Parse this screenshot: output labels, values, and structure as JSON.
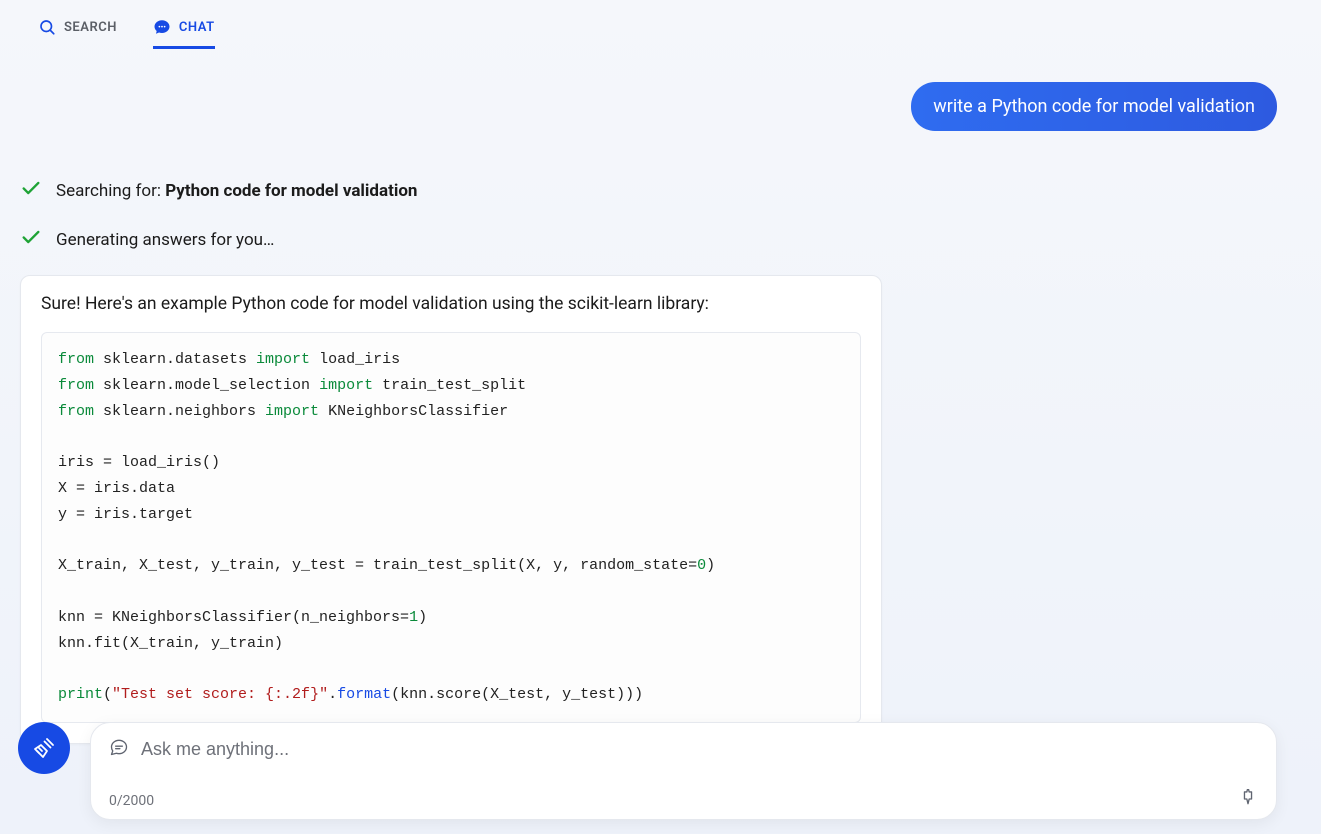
{
  "tabs": {
    "search_label": "SEARCH",
    "chat_label": "CHAT"
  },
  "user_message": "write a Python code for model validation",
  "status": {
    "searching_prefix": "Searching for: ",
    "searching_query": "Python code for model validation",
    "generating": "Generating answers for you…"
  },
  "answer": {
    "intro": "Sure! Here's an example Python code for model validation using the scikit-learn library:",
    "code": {
      "line1_from": "from",
      "line1_mod": " sklearn.datasets ",
      "line1_import": "import",
      "line1_rest": " load_iris",
      "line2_from": "from",
      "line2_mod": " sklearn.model_selection ",
      "line2_import": "import",
      "line2_rest": " train_test_split",
      "line3_from": "from",
      "line3_mod": " sklearn.neighbors ",
      "line3_import": "import",
      "line3_rest": " KNeighborsClassifier",
      "line4": "iris = load_iris()",
      "line5": "X = iris.data",
      "line6": "y = iris.target",
      "line7_pre": "X_train, X_test, y_train, y_test = train_test_split(X, y, random_state=",
      "line7_num": "0",
      "line7_post": ")",
      "line8_pre": "knn = KNeighborsClassifier(n_neighbors=",
      "line8_num": "1",
      "line8_post": ")",
      "line9": "knn.fit(X_train, y_train)",
      "line10_print": "print",
      "line10_open": "(",
      "line10_str": "\"Test set score: {:.2f}\"",
      "line10_dot": ".",
      "line10_fmt": "format",
      "line10_rest": "(knn.score(X_test, y_test)))"
    }
  },
  "input": {
    "placeholder": "Ask me anything...",
    "counter": "0/2000"
  }
}
